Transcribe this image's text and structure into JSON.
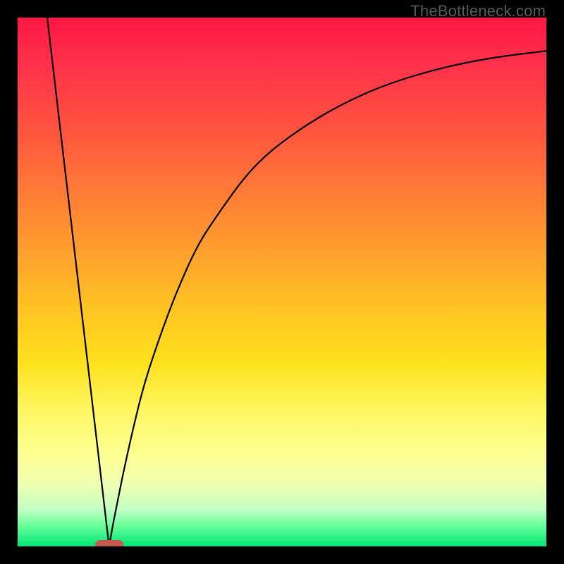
{
  "watermark": "TheBottleneck.com",
  "chart_data": {
    "type": "line",
    "title": "",
    "xlabel": "",
    "ylabel": "",
    "x_range": [
      0,
      100
    ],
    "y_range": [
      0,
      100
    ],
    "grid": false,
    "legend": false,
    "background_gradient": {
      "top_color": "#ff1744",
      "mid_colors": [
        "#ff7b36",
        "#ffe11c"
      ],
      "bottom_color": "#00e676"
    },
    "series": [
      {
        "name": "left-line",
        "x": [
          5.6,
          17.3
        ],
        "y": [
          100,
          0
        ]
      },
      {
        "name": "right-curve",
        "x": [
          17.3,
          18,
          19,
          20,
          22,
          24,
          27,
          30,
          34,
          38,
          43,
          48,
          55,
          62,
          70,
          80,
          90,
          100
        ],
        "y": [
          0,
          4,
          9,
          14,
          23,
          31,
          40,
          48,
          57,
          63,
          70,
          75,
          80,
          84,
          87.5,
          90.5,
          92.5,
          93.7
        ]
      }
    ],
    "marker": {
      "shape": "pill",
      "color": "#c6584d",
      "x_center": 17.3,
      "width_pct": 5.3,
      "y": 0
    }
  }
}
